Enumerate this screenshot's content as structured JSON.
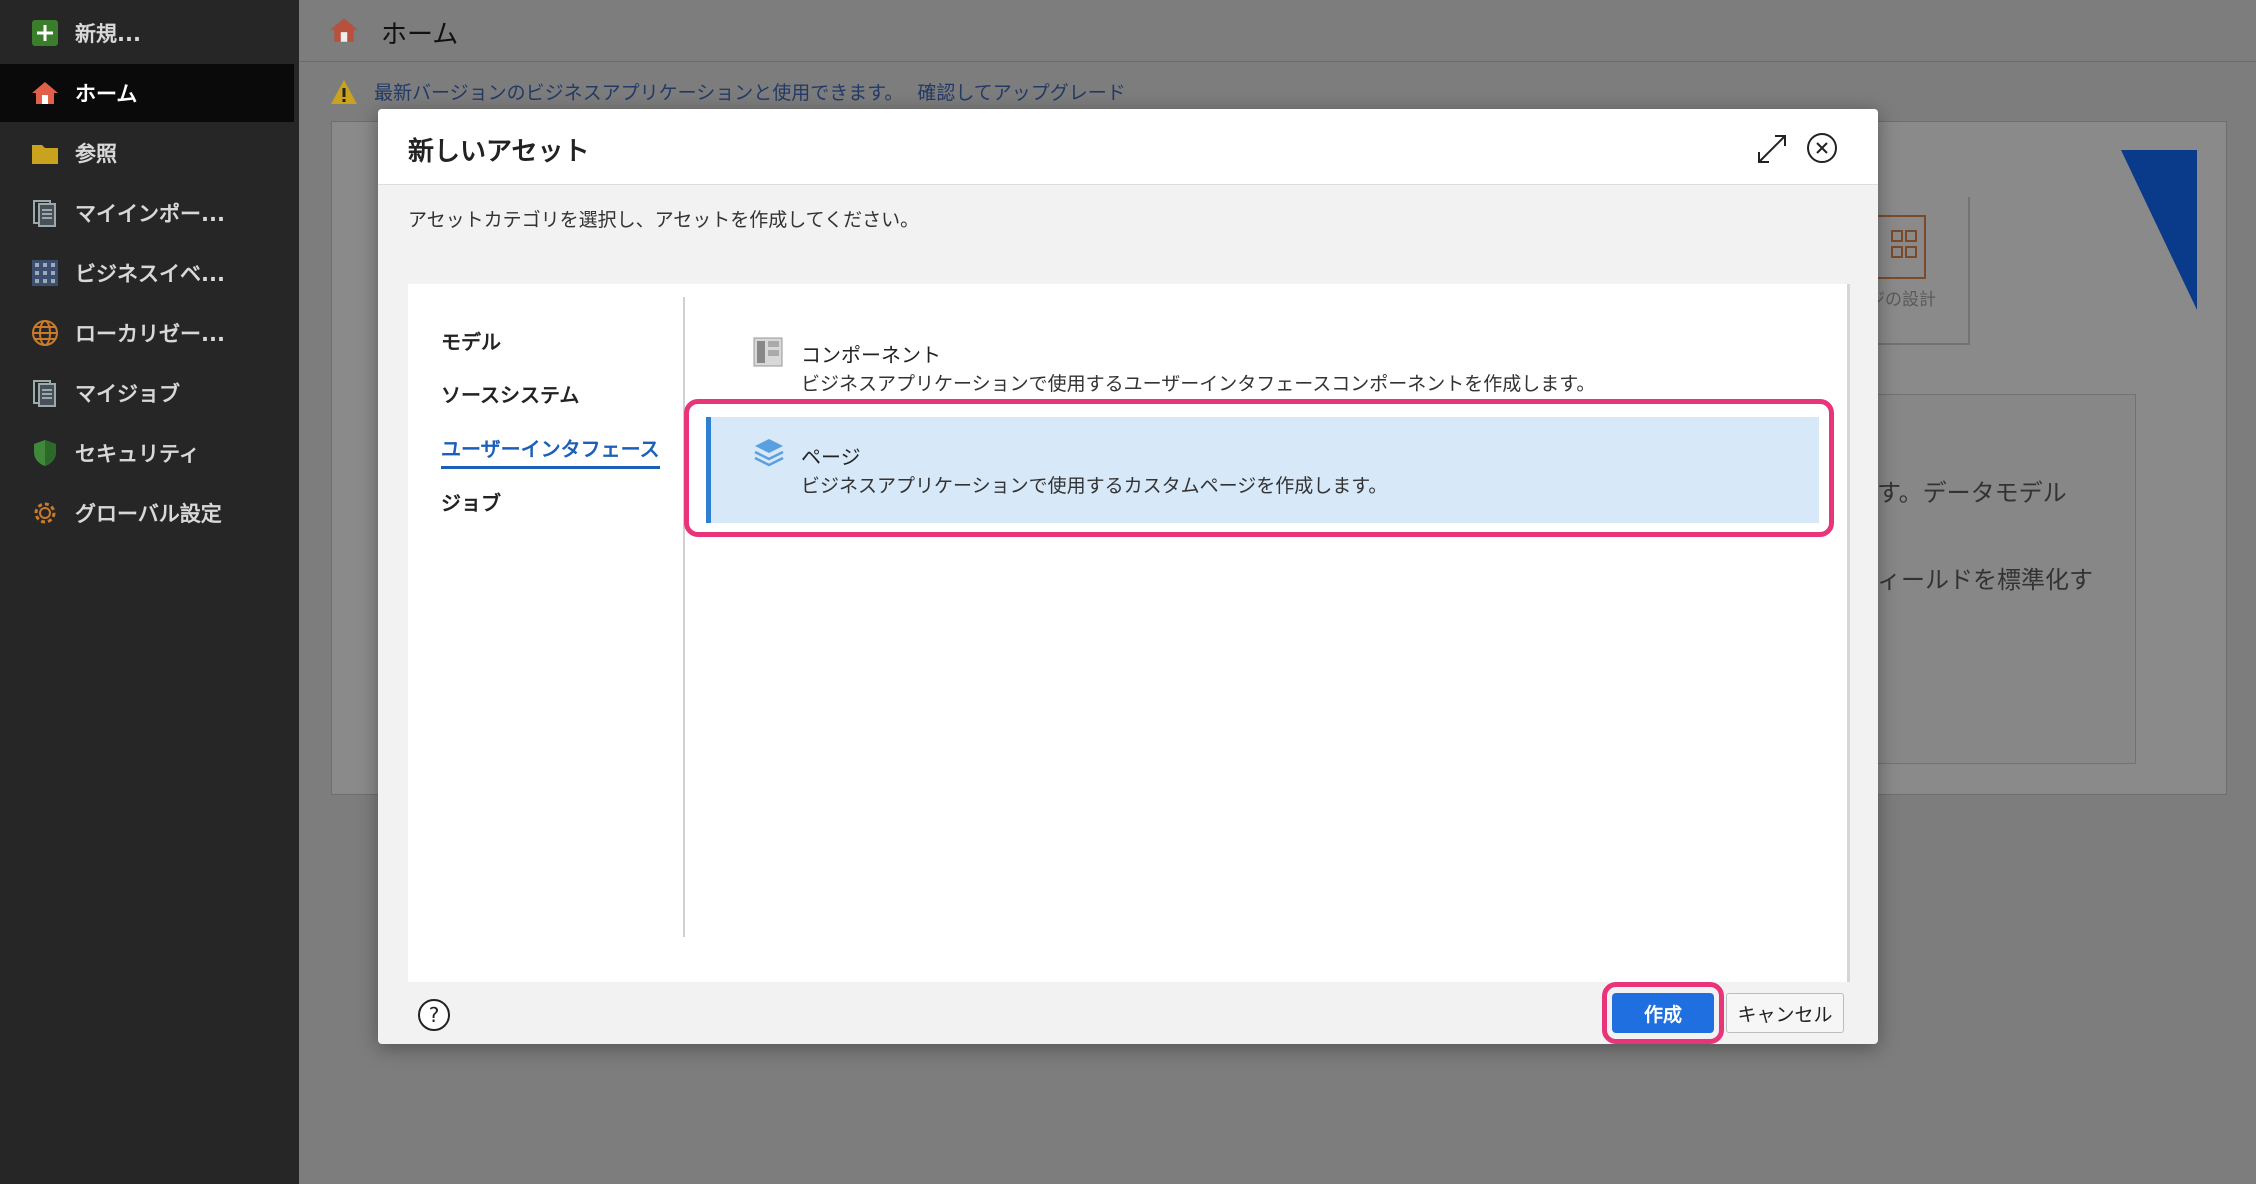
{
  "sidebar": {
    "items": [
      {
        "label": "新規...",
        "icon": "plus-icon"
      },
      {
        "label": "ホーム",
        "icon": "home-icon"
      },
      {
        "label": "参照",
        "icon": "folder-icon"
      },
      {
        "label": "マイインポー...",
        "icon": "document-icon"
      },
      {
        "label": "ビジネスイベ...",
        "icon": "grid-icon"
      },
      {
        "label": "ローカリゼー...",
        "icon": "globe-icon"
      },
      {
        "label": "マイジョブ",
        "icon": "document-icon"
      },
      {
        "label": "セキュリティ",
        "icon": "shield-icon"
      },
      {
        "label": "グローバル設定",
        "icon": "gear-icon"
      }
    ]
  },
  "header": {
    "title": "ホーム"
  },
  "warning": {
    "text": "最新バージョンのビジネスアプリケーションと使用できます。",
    "link": "確認してアップグレード"
  },
  "background": {
    "tile_label": "ジの設計",
    "panel_line1": "す。データモデル",
    "panel_line2": "ィールドを標準化す"
  },
  "modal": {
    "title": "新しいアセット",
    "description": "アセットカテゴリを選択し、アセットを作成してください。",
    "categories": [
      "モデル",
      "ソースシステム",
      "ユーザーインタフェース",
      "ジョブ"
    ],
    "active_category": "ユーザーインタフェース",
    "assets": [
      {
        "title": "コンポーネント",
        "description": "ビジネスアプリケーションで使用するユーザーインタフェースコンポーネントを作成します。",
        "icon": "component-icon"
      },
      {
        "title": "ページ",
        "description": "ビジネスアプリケーションで使用するカスタムページを作成します。",
        "icon": "layers-icon"
      }
    ],
    "selected_asset": "ページ",
    "help_label": "?",
    "create_label": "作成",
    "cancel_label": "キャンセル"
  },
  "colors": {
    "accent": "#1f6fe0",
    "highlight": "#e8357a",
    "selected_bg": "#d7e8f8"
  }
}
